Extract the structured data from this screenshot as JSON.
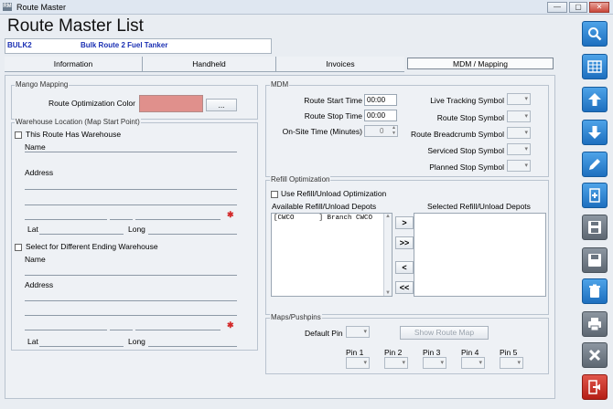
{
  "window": {
    "title": "Route Master",
    "logo_text": "RM",
    "minimize": "—",
    "restore": "▢",
    "close": "✕"
  },
  "page": {
    "title": "Route Master List",
    "route_id": "BULK2",
    "route_desc": "Bulk Route 2 Fuel Tanker"
  },
  "tabs": [
    {
      "label": "Information"
    },
    {
      "label": "Handheld"
    },
    {
      "label": "Invoices"
    },
    {
      "label": "MDM / Mapping"
    }
  ],
  "mango": {
    "group_label": "Mango Mapping",
    "color_label": "Route Optimization Color",
    "color_value": "#e0908c",
    "browse_label": "..."
  },
  "warehouse": {
    "group_label": "Warehouse Location (Map Start Point)",
    "has_warehouse_label": "This Route Has Warehouse",
    "name_label": "Name",
    "address_label": "Address",
    "lat_label": "Lat",
    "long_label": "Long",
    "diff_ending_label": "Select for Different Ending Warehouse",
    "end_name_label": "Name",
    "end_address_label": "Address",
    "end_lat_label": "Lat",
    "end_long_label": "Long"
  },
  "mdm": {
    "group_label": "MDM",
    "start_time_label": "Route Start Time",
    "start_time_value": "00:00",
    "stop_time_label": "Route Stop Time",
    "stop_time_value": "00:00",
    "onsite_label": "On-Site Time (Minutes)",
    "onsite_value": "0",
    "live_tracking_label": "Live Tracking Symbol",
    "route_stop_label": "Route Stop Symbol",
    "breadcrumb_label": "Route Breadcrumb Symbol",
    "serviced_label": "Serviced Stop Symbol",
    "planned_label": "Planned Stop Symbol"
  },
  "refill": {
    "group_label": "Refill Optimization",
    "use_label": "Use Refill/Unload Optimization",
    "available_label": "Available Refill/Unload Depots",
    "selected_label": "Selected Refill/Unload Depots",
    "available_items": [
      "[CWCO      ] Branch CWCO"
    ],
    "add_label": ">",
    "add_all_label": ">>",
    "remove_label": "<",
    "remove_all_label": "<<"
  },
  "maps": {
    "group_label": "Maps/Pushpins",
    "default_pin_label": "Default Pin",
    "show_map_label": "Show Route Map",
    "pins": [
      {
        "label": "Pin 1"
      },
      {
        "label": "Pin 2"
      },
      {
        "label": "Pin 3"
      },
      {
        "label": "Pin 4"
      },
      {
        "label": "Pin 5"
      }
    ]
  },
  "colors": {
    "accent": "#1d6fbf",
    "route_text": "#1a2fb3",
    "danger": "#b51f16"
  },
  "toolbar_icons": [
    "search-icon",
    "grid-icon",
    "arrow-up-icon",
    "arrow-down-icon",
    "pencil-icon",
    "new-document-icon",
    "save-new-icon",
    "save-icon",
    "trash-icon",
    "print-icon",
    "cancel-icon",
    "exit-icon"
  ]
}
